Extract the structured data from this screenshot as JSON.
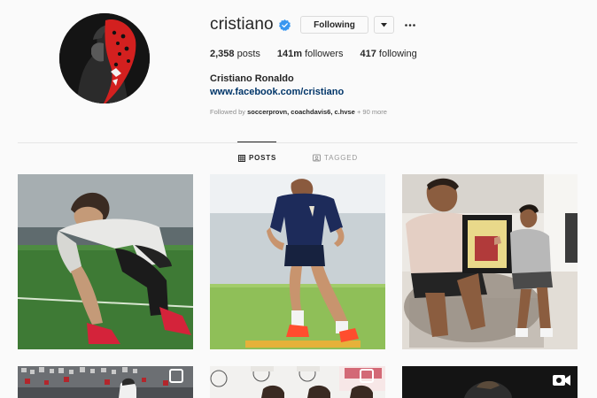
{
  "profile": {
    "username": "cristiano",
    "verified_icon": "verified-badge-icon",
    "following_label": "Following",
    "dropdown_icon": "caret-down-icon",
    "more_icon": "ellipsis-icon",
    "posts_count": "2,358",
    "posts_label": "posts",
    "followers_count": "141m",
    "followers_label": "followers",
    "following_count": "417",
    "following_label2": "following",
    "full_name": "Cristiano Ronaldo",
    "link": "www.facebook.com/cristiano",
    "followed_by_prefix": "Followed by",
    "followed_by_names": "soccerprovn, coachdavis6, c.hvse",
    "followed_by_suffix": "+ 90 more"
  },
  "tabs": [
    {
      "label": "POSTS",
      "icon": "grid-icon",
      "active": true
    },
    {
      "label": "TAGGED",
      "icon": "tagged-icon",
      "active": false
    }
  ],
  "colors": {
    "verified_blue": "#3897f0",
    "link": "#003569",
    "secondary_text": "#8e8e8e"
  },
  "posts": [
    {
      "subject": "player tying boot on grass"
    },
    {
      "subject": "player in training kit running"
    },
    {
      "subject": "player with boy holding framed shirt"
    },
    {
      "subject": "stadium crowd"
    },
    {
      "subject": "sponsor backdrop"
    },
    {
      "subject": "video post",
      "icon": "video-icon"
    }
  ]
}
